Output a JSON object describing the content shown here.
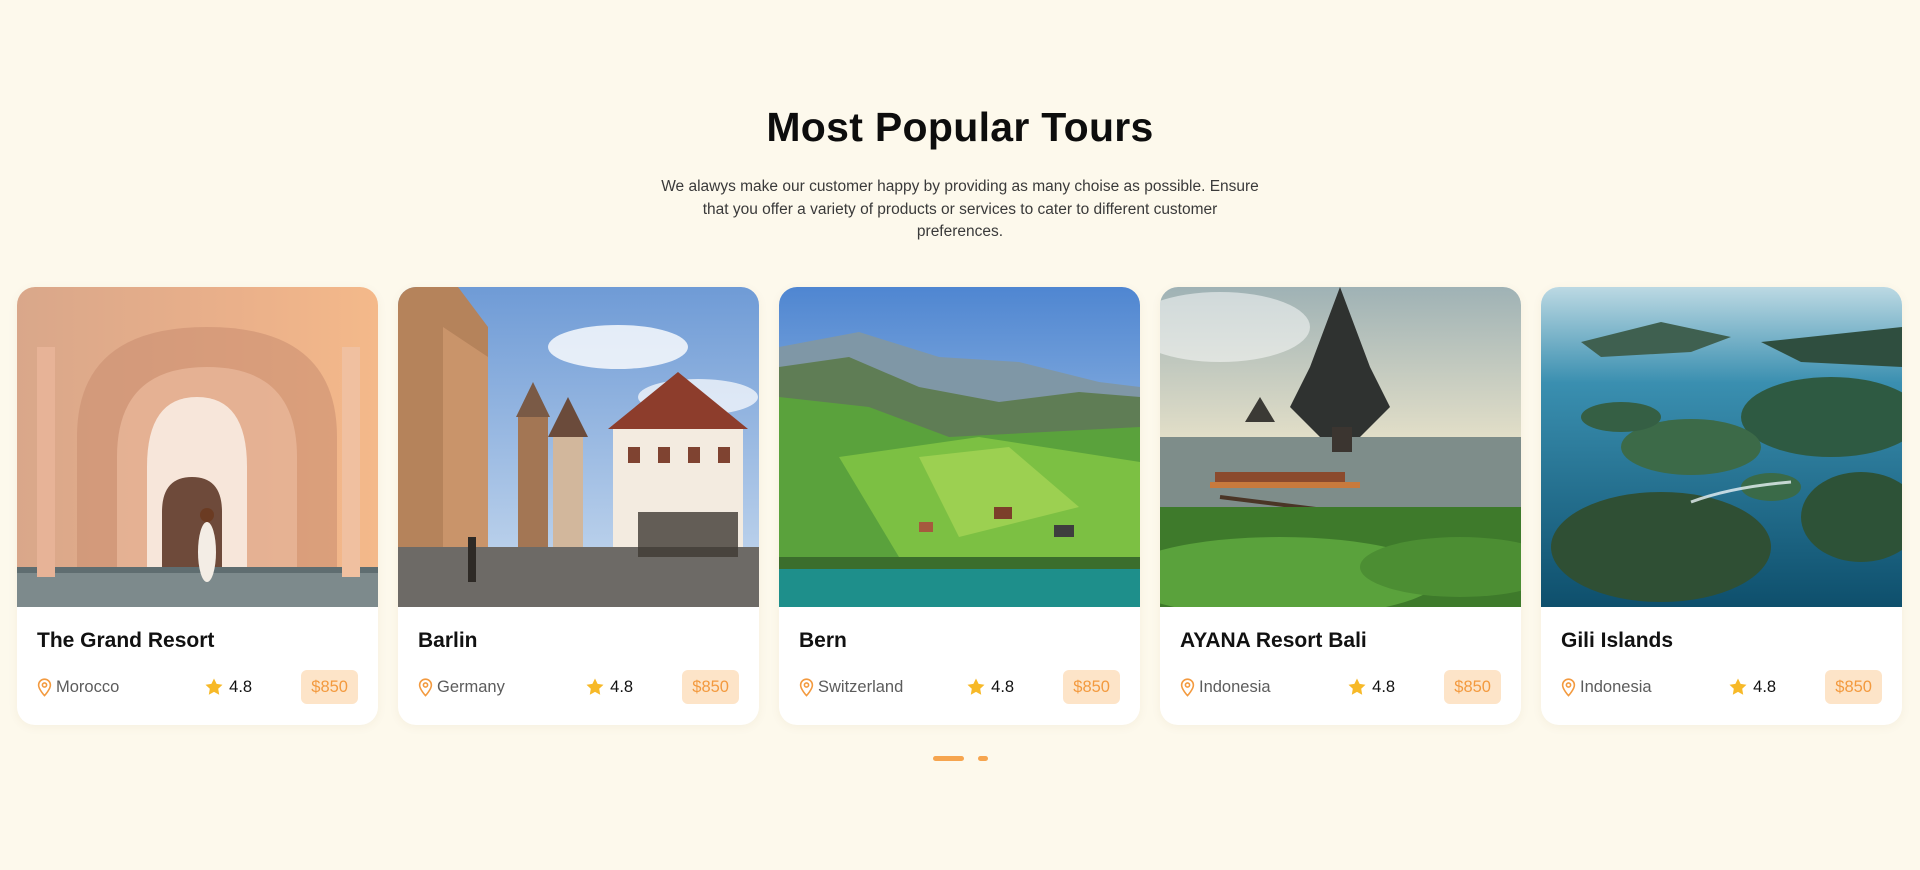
{
  "section": {
    "title": "Most Popular Tours",
    "subtitle": "We alawys make our customer happy by providing as many choise as possible. Ensure that you offer a variety of products or services to cater to different customer preferences."
  },
  "tours": [
    {
      "title": "The Grand Resort",
      "location": "Morocco",
      "rating": "4.8",
      "price": "$850",
      "image": "morocco-arches"
    },
    {
      "title": "Barlin",
      "location": "Germany",
      "rating": "4.8",
      "price": "$850",
      "image": "german-old-town"
    },
    {
      "title": "Bern",
      "location": "Switzerland",
      "rating": "4.8",
      "price": "$850",
      "image": "swiss-valley"
    },
    {
      "title": "AYANA Resort Bali",
      "location": "Indonesia",
      "rating": "4.8",
      "price": "$850",
      "image": "bali-temple"
    },
    {
      "title": "Gili Islands",
      "location": "Indonesia",
      "rating": "4.8",
      "price": "$850",
      "image": "islands-aerial"
    }
  ],
  "carousel": {
    "page_count": 2,
    "active_page": 1
  },
  "colors": {
    "background": "#fdf9ec",
    "accent": "#f39a3f",
    "price_bg": "#fde4c8",
    "star": "#f7b928"
  },
  "icons": {
    "location": "map-pin-icon",
    "rating": "star-icon"
  }
}
